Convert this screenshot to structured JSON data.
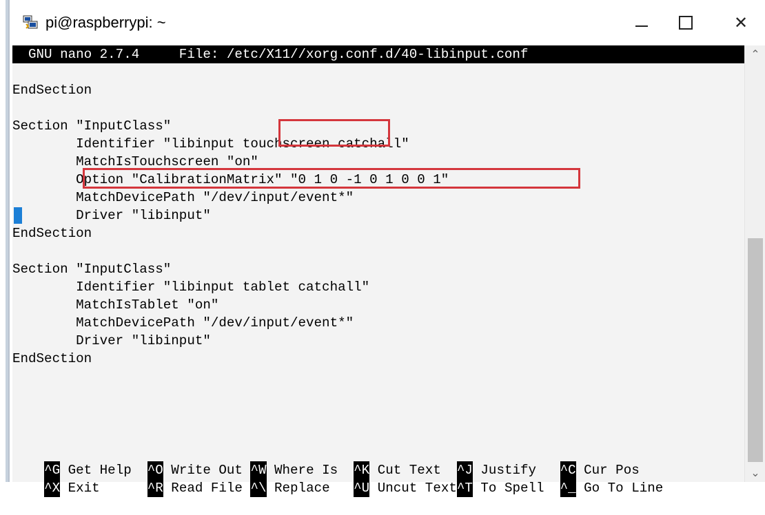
{
  "window": {
    "title": "pi@raspberrypi: ~",
    "minimize": "—",
    "maximize": "☐",
    "close": "✕"
  },
  "nano": {
    "header": "  GNU nano 2.7.4     File: /etc/X11//xorg.conf.d/40-libinput.conf",
    "lines": [
      "",
      "EndSection",
      "",
      "Section \"InputClass\"",
      "        Identifier \"libinput touchscreen catchall\"",
      "        MatchIsTouchscreen \"on\"",
      "        Option \"CalibrationMatrix\" \"0 1 0 -1 0 1 0 0 1\"",
      "        MatchDevicePath \"/dev/input/event*\"",
      "        Driver \"libinput\"",
      "EndSection",
      "",
      "Section \"InputClass\"",
      "        Identifier \"libinput tablet catchall\"",
      "        MatchIsTablet \"on\"",
      "        MatchDevicePath \"/dev/input/event*\"",
      "        Driver \"libinput\"",
      "EndSection"
    ],
    "shortcuts_row1": [
      {
        "key": "^G",
        "label": " Get Help  "
      },
      {
        "key": "^O",
        "label": " Write Out "
      },
      {
        "key": "^W",
        "label": " Where Is  "
      },
      {
        "key": "^K",
        "label": " Cut Text  "
      },
      {
        "key": "^J",
        "label": " Justify   "
      },
      {
        "key": "^C",
        "label": " Cur Pos"
      }
    ],
    "shortcuts_row2": [
      {
        "key": "^X",
        "label": " Exit      "
      },
      {
        "key": "^R",
        "label": " Read File "
      },
      {
        "key": "^\\",
        "label": " Replace   "
      },
      {
        "key": "^U",
        "label": " Uncut Text"
      },
      {
        "key": "^T",
        "label": " To Spell  "
      },
      {
        "key": "^_",
        "label": " Go To Line"
      }
    ]
  },
  "colors": {
    "terminal_bg": "#f3f3f3",
    "highlight_box": "#d4363c",
    "cursor": "#1c7fd6"
  }
}
